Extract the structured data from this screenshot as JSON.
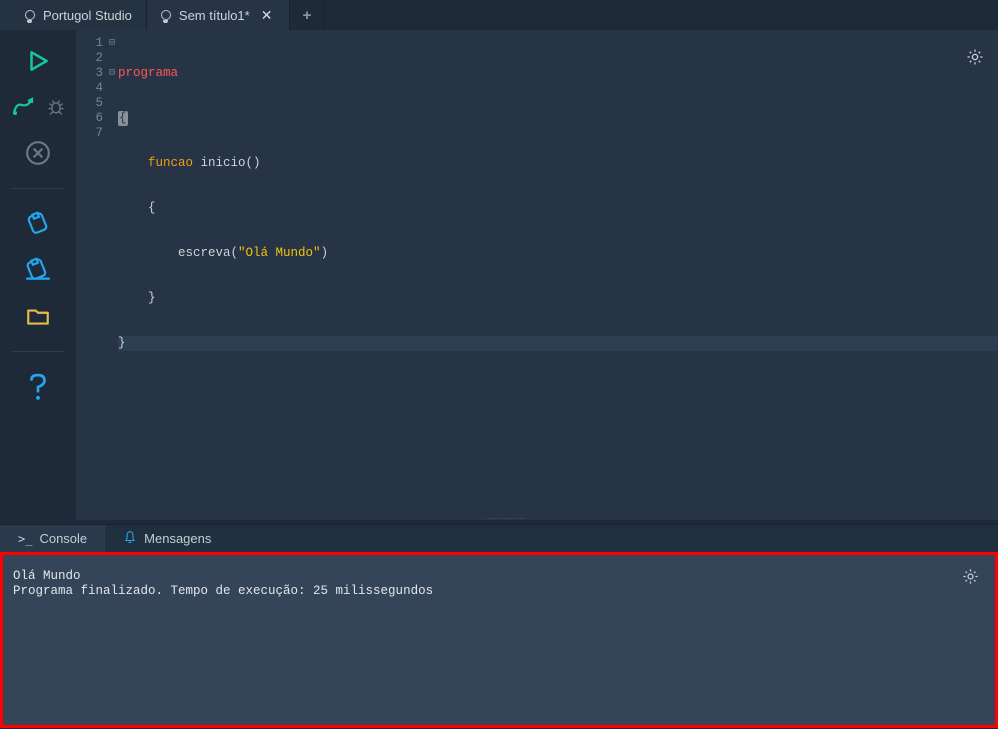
{
  "tabs": {
    "home_label": "Portugol Studio",
    "file_label": "Sem título1*",
    "close_glyph": "✕",
    "new_glyph": "+"
  },
  "gutter": {
    "l1": "1",
    "l2": "2",
    "l3": "3",
    "l4": "4",
    "l5": "5",
    "l6": "6",
    "l7": "7"
  },
  "fold": {
    "l1": "⊟",
    "l3": "⊟"
  },
  "code": {
    "l1_kw": "programa",
    "l2_brace": "{",
    "l3_kw": "funcao",
    "l3_name": " inicio",
    "l3_paren": "()",
    "l4_brace": "    {",
    "l5_fn": "        escreva",
    "l5_open": "(",
    "l5_str": "\"Olá Mundo\"",
    "l5_close": ")",
    "l6_brace": "    }",
    "l7_brace": "}"
  },
  "panel": {
    "console_label": "Console",
    "mensagens_label": "Mensagens",
    "prompt_glyph": ">_"
  },
  "console": {
    "line1": "Olá Mundo",
    "line2": "Programa finalizado. Tempo de execução: 25 milissegundos"
  },
  "splitter_dots": "............."
}
